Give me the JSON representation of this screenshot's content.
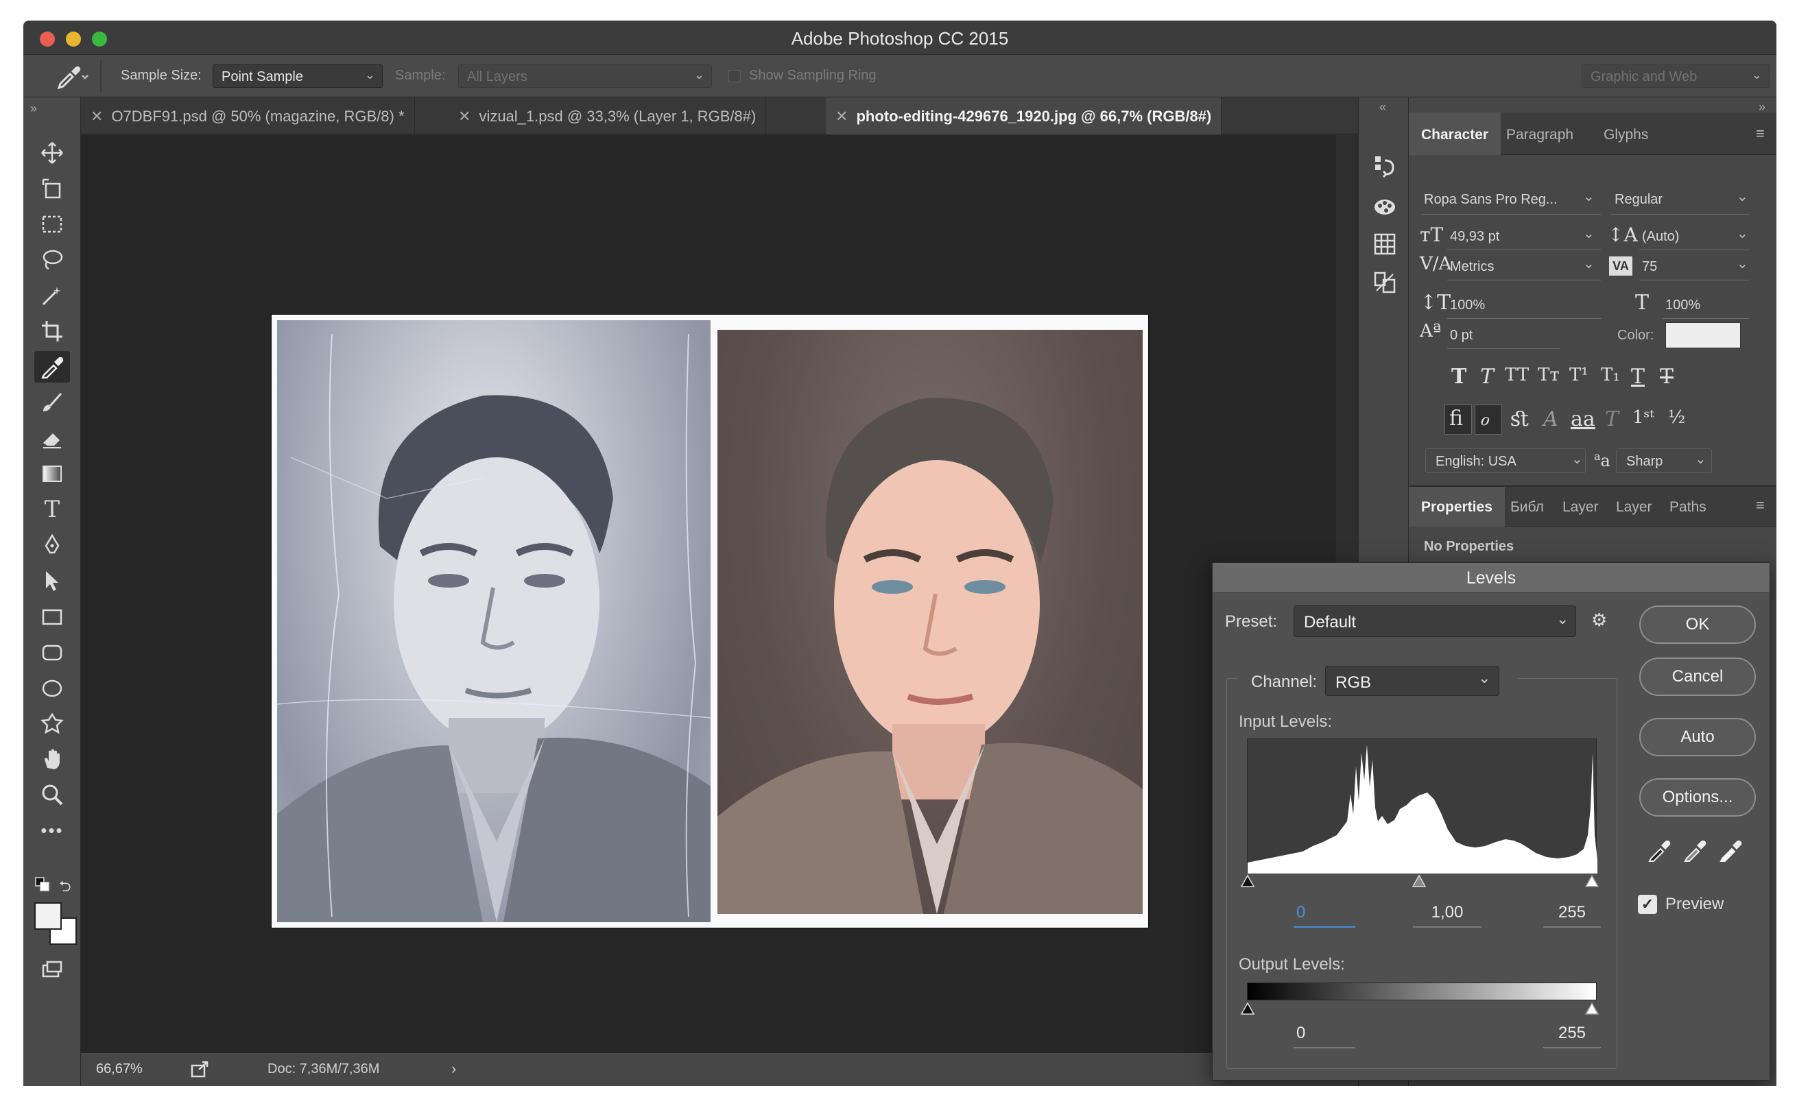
{
  "window": {
    "title": "Adobe Photoshop CC 2015"
  },
  "options_bar": {
    "sample_size_label": "Sample Size:",
    "sample_size_value": "Point Sample",
    "sample_label": "Sample:",
    "sample_value": "All Layers",
    "show_sampling_ring_label": "Show Sampling Ring",
    "workspace": "Graphic and Web"
  },
  "document_tabs": [
    {
      "label": "O7DBF91.psd @ 50% (magazine, RGB/8) *",
      "active": false
    },
    {
      "label": "vizual_1.psd @ 33,3% (Layer 1, RGB/8#)",
      "active": false
    },
    {
      "label": "photo-editing-429676_1920.jpg @ 66,7% (RGB/8#)",
      "active": true
    }
  ],
  "status_bar": {
    "zoom": "66,67%",
    "doc": "Doc: 7,36M/7,36M"
  },
  "tools": [
    "move-icon",
    "artboard-icon",
    "marquee-icon",
    "lasso-icon",
    "magic-wand-icon",
    "crop-icon",
    "eyedropper-icon",
    "brush-icon",
    "eraser-icon",
    "gradient-icon",
    "type-icon",
    "pen-icon",
    "path-select-icon",
    "rectangle-icon",
    "rounded-rect-icon",
    "ellipse-icon",
    "custom-shape-icon",
    "hand-icon",
    "zoom-icon",
    "more-tools-icon"
  ],
  "character_panel": {
    "tabs": [
      "Character",
      "Paragraph",
      "Glyphs"
    ],
    "font_family": "Ropa Sans Pro Reg...",
    "font_style": "Regular",
    "font_size": "49,93 pt",
    "leading": "(Auto)",
    "kerning": "Metrics",
    "tracking": "75",
    "vertical_scale": "100%",
    "horizontal_scale": "100%",
    "baseline_shift": "0 pt",
    "color_label": "Color:",
    "color_value": "#ededed",
    "language": "English: USA",
    "antialias": "Sharp",
    "antialias_label": "a",
    "antialias_label_sub": "a"
  },
  "properties_panel": {
    "tabs": [
      "Properties",
      "Библ",
      "Layer",
      "Layer",
      "Paths"
    ],
    "content": "No Properties"
  },
  "levels_dialog": {
    "title": "Levels",
    "preset_label": "Preset:",
    "preset_value": "Default",
    "channel_label": "Channel:",
    "channel_value": "RGB",
    "input_levels_label": "Input Levels:",
    "input_black": "0",
    "input_gamma": "1,00",
    "input_white": "255",
    "output_levels_label": "Output Levels:",
    "output_black": "0",
    "output_white": "255",
    "buttons": {
      "ok": "OK",
      "cancel": "Cancel",
      "auto": "Auto",
      "options": "Options..."
    },
    "preview_label": "Preview",
    "preview_checked": true
  },
  "colors": {
    "accent_blue": "#4a90d9",
    "close_red": "#ec5e55",
    "minimize_yellow": "#e8b730",
    "zoom_green": "#3ab93f"
  }
}
